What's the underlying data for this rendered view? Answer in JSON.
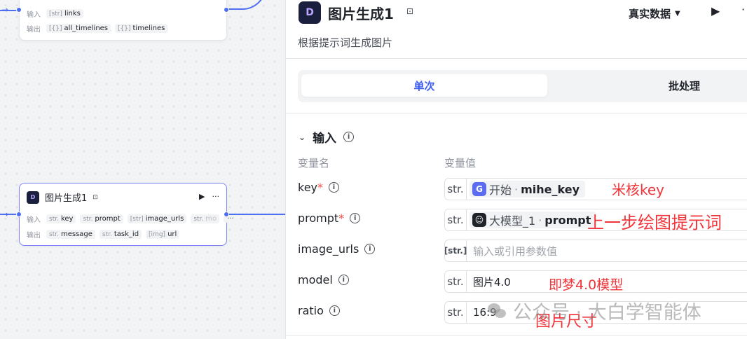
{
  "canvas": {
    "top_node": {
      "input_label": "输入",
      "input_chips": [
        {
          "type": "[str]",
          "name": "links"
        }
      ],
      "output_label": "输出",
      "output_chips": [
        {
          "type": "[{}]",
          "name": "all_timelines"
        },
        {
          "type": "[{}]",
          "name": "timelines"
        }
      ]
    },
    "image_node": {
      "title": "图片生成1",
      "input_label": "输入",
      "input_chips": [
        {
          "type": "str.",
          "name": "key"
        },
        {
          "type": "str.",
          "name": "prompt"
        },
        {
          "type": "[str]",
          "name": "image_urls"
        },
        {
          "type": "str.",
          "name": "mo"
        }
      ],
      "input_more": "···",
      "output_label": "输出",
      "output_chips": [
        {
          "type": "str.",
          "name": "message"
        },
        {
          "type": "str.",
          "name": "task_id"
        },
        {
          "type": "[img]",
          "name": "url"
        }
      ]
    }
  },
  "panel": {
    "title": "图片生成1",
    "mode_label": "真实数据",
    "description": "根据提示词生成图片",
    "tabs": [
      "单次",
      "批处理"
    ],
    "section_title": "输入",
    "col_name": "变量名",
    "col_value": "变量值",
    "params": [
      {
        "name": "key",
        "required": true,
        "type": "str.",
        "ref_source": "开始",
        "ref_var": "mihe_key",
        "annotation": "米核key"
      },
      {
        "name": "prompt",
        "required": true,
        "type": "str.",
        "ref_source": "大模型_1",
        "ref_var": "prompt",
        "annotation": "上一步绘图提示词"
      },
      {
        "name": "image_urls",
        "required": false,
        "type": "[str.]",
        "placeholder": "输入或引用参数值"
      },
      {
        "name": "model",
        "required": false,
        "type": "str.",
        "value": "图片4.0",
        "annotation": "即梦4.0模型"
      },
      {
        "name": "ratio",
        "required": false,
        "type": "str.",
        "value": "16:9",
        "annotation": "图片尺寸"
      }
    ]
  },
  "watermark": "公众号 · 大白学智能体",
  "colors": {
    "accent": "#3c5bf0",
    "annotation": "#f0343a",
    "edge": "#4e6ef2"
  }
}
